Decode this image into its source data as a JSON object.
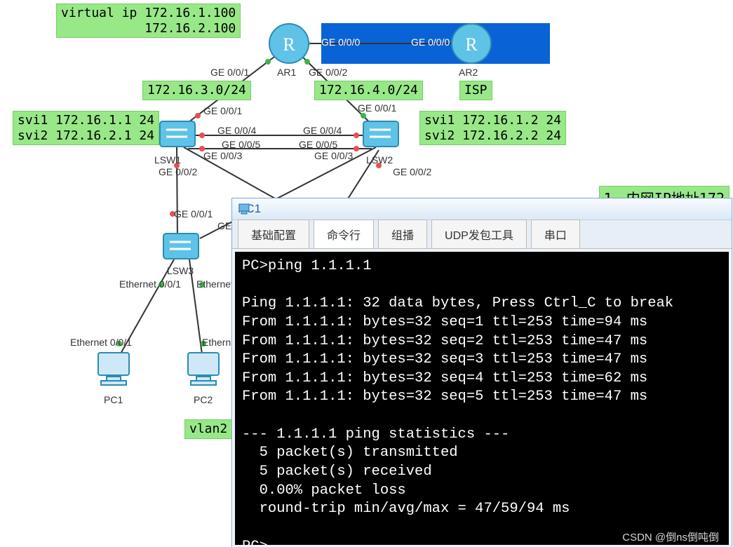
{
  "topology": {
    "notes": {
      "virtual_ip": "virtual ip 172.16.1.100\n           172.16.2.100",
      "link_ar1_lsw1": "172.16.3.0/24",
      "link_ar1_lsw2": "172.16.4.0/24",
      "svi_left": "svi1 172.16.1.1 24\nsvi2 172.16.2.1 24",
      "svi_right": "svi1 172.16.1.2 24\nsvi2 172.16.2.2 24",
      "isp": "ISP",
      "vlan2": "vlan2",
      "sidecheck": "1、内网IP地址172"
    },
    "nodes": {
      "ar1": "AR1",
      "ar2": "AR2",
      "lsw1": "LSW1",
      "lsw2": "LSW2",
      "lsw3": "LSW3",
      "pc1": "PC1",
      "pc2": "PC2"
    },
    "ports": {
      "ar1_left": "GE 0/0/1",
      "ar1_right": "GE 0/0/2",
      "ar1_e000": "GE 0/0/0",
      "ar2_e000": "GE 0/0/0",
      "lsw1_up": "GE 0/0/1",
      "lsw2_up": "GE 0/0/1",
      "lsw1_ge4": "GE 0/0/4",
      "lsw2_ge4": "GE 0/0/4",
      "lsw1_ge5": "GE 0/0/5",
      "lsw2_ge5": "GE 0/0/5",
      "lsw1_ge3": "GE 0/0/3",
      "lsw2_ge3": "GE 0/0/3",
      "lsw1_ge2": "GE 0/0/2",
      "lsw2_ge2": "GE 0/0/2",
      "lsw3_ge1": "GE 0/0/1",
      "lsw3_ge2": "GE",
      "lsw3_e1": "Ethernet 0/0/1",
      "lsw3_e2": "Ethernet",
      "pc1_e": "Ethernet 0/0/1",
      "pc2_e": "Ethern"
    }
  },
  "window": {
    "title": "PC1",
    "tabs": [
      "基础配置",
      "命令行",
      "组播",
      "UDP发包工具",
      "串口"
    ],
    "active_tab": 1,
    "terminal": "PC>ping 1.1.1.1\n\nPing 1.1.1.1: 32 data bytes, Press Ctrl_C to break\nFrom 1.1.1.1: bytes=32 seq=1 ttl=253 time=94 ms\nFrom 1.1.1.1: bytes=32 seq=2 ttl=253 time=47 ms\nFrom 1.1.1.1: bytes=32 seq=3 ttl=253 time=47 ms\nFrom 1.1.1.1: bytes=32 seq=4 ttl=253 time=62 ms\nFrom 1.1.1.1: bytes=32 seq=5 ttl=253 time=47 ms\n\n--- 1.1.1.1 ping statistics ---\n  5 packet(s) transmitted\n  5 packet(s) received\n  0.00% packet loss\n  round-trip min/avg/max = 47/59/94 ms\n\nPC>"
  },
  "watermark": "CSDN @倒ns倒吨倒"
}
